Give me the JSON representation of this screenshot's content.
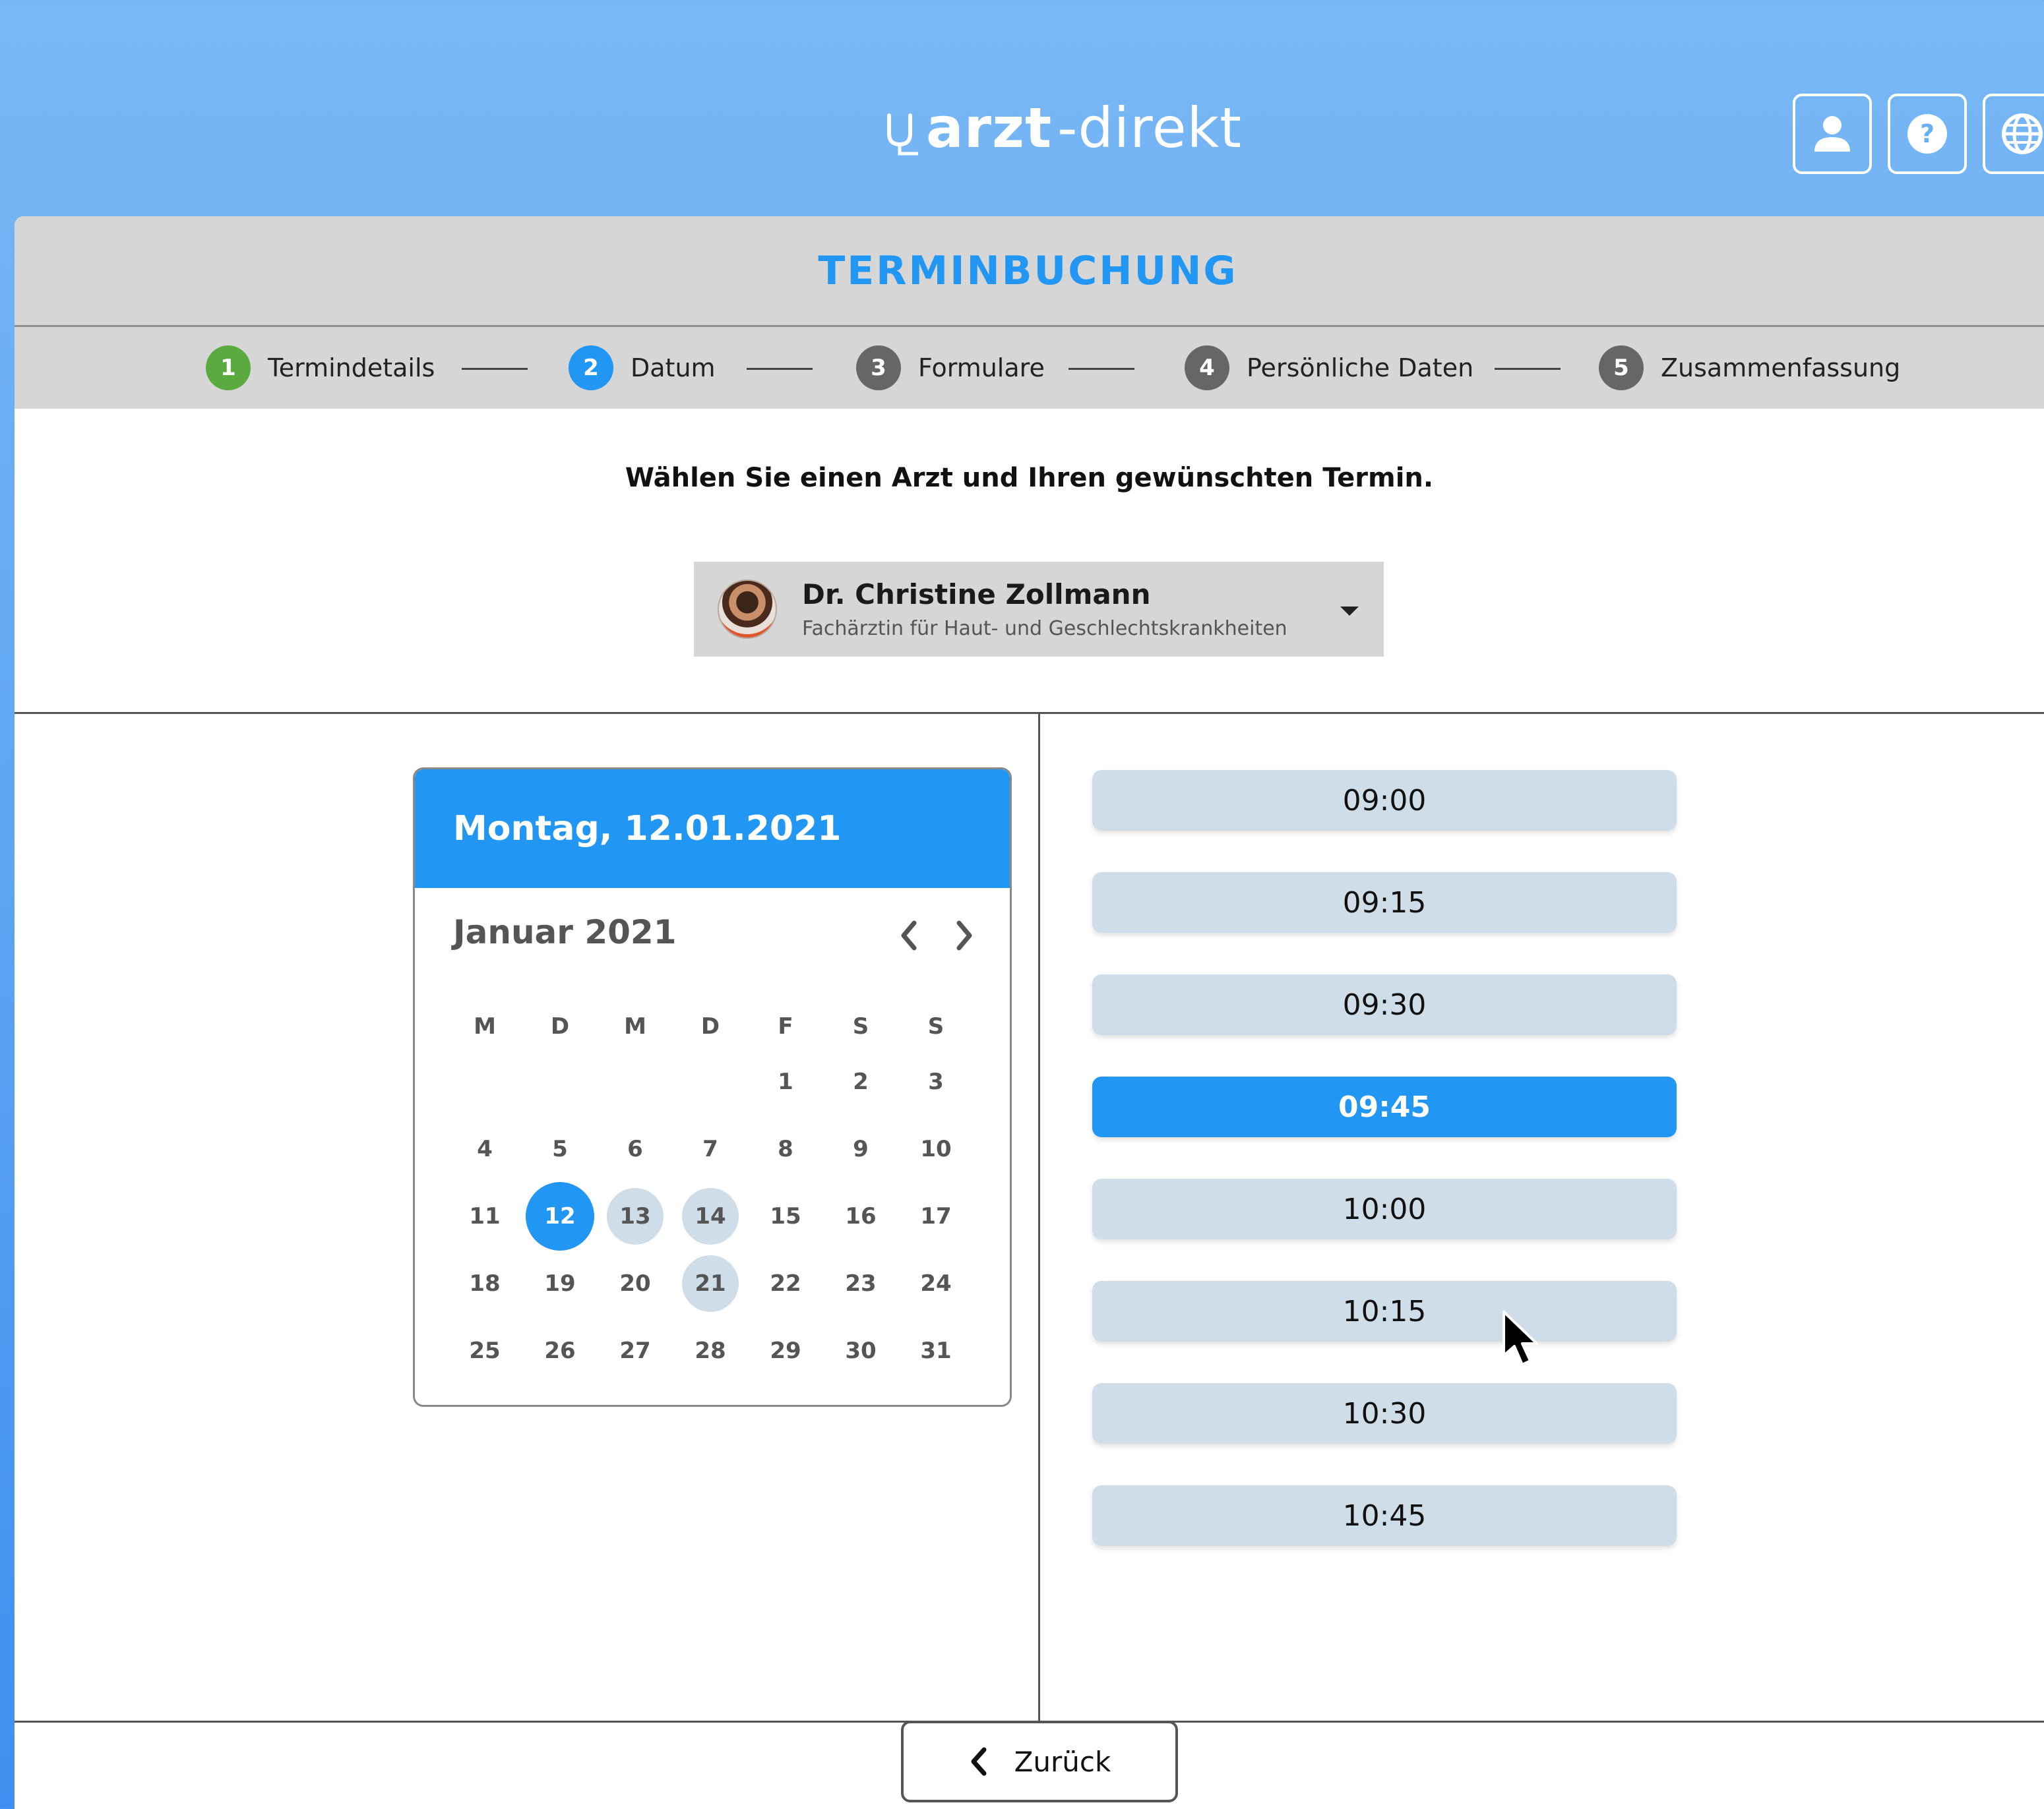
{
  "header": {
    "logo_bold": "arzt",
    "logo_light": "-direkt",
    "icons": [
      "user-icon",
      "help-icon",
      "globe-icon"
    ]
  },
  "page": {
    "title": "TERMINBUCHUNG",
    "prompt": "Wählen Sie einen Arzt und Ihren gewünschten Termin."
  },
  "steps": [
    {
      "num": "1",
      "label": "Termindetails",
      "state": "done",
      "color": "#5aaa3f"
    },
    {
      "num": "2",
      "label": "Datum",
      "state": "active",
      "color": "#2196f3"
    },
    {
      "num": "3",
      "label": "Formulare",
      "state": "pending",
      "color": "#666666"
    },
    {
      "num": "4",
      "label": "Persönliche Daten",
      "state": "pending",
      "color": "#666666"
    },
    {
      "num": "5",
      "label": "Zusammenfassung",
      "state": "pending",
      "color": "#666666"
    }
  ],
  "doctor": {
    "name": "Dr. Christine Zollmann",
    "specialty": "Fachärztin für Haut- und Geschlechtskrankheiten"
  },
  "calendar": {
    "selected_label": "Montag, 12.01.2021",
    "month_label": "Januar 2021",
    "weekdays": [
      "M",
      "D",
      "M",
      "D",
      "F",
      "S",
      "S"
    ],
    "first_weekday_index": 4,
    "days_in_month": 31,
    "selected_day": 12,
    "available_days": [
      13,
      14,
      21
    ]
  },
  "time_slots": [
    "09:00",
    "09:15",
    "09:30",
    "09:45",
    "10:00",
    "10:15",
    "10:30",
    "10:45"
  ],
  "selected_slot": "09:45",
  "footer": {
    "back_label": "Zurück"
  },
  "colors": {
    "accent": "#2196f3",
    "done_step": "#5aaa3f",
    "slot_bg": "#cfdde9",
    "panel_gray": "#d6d6d6"
  }
}
